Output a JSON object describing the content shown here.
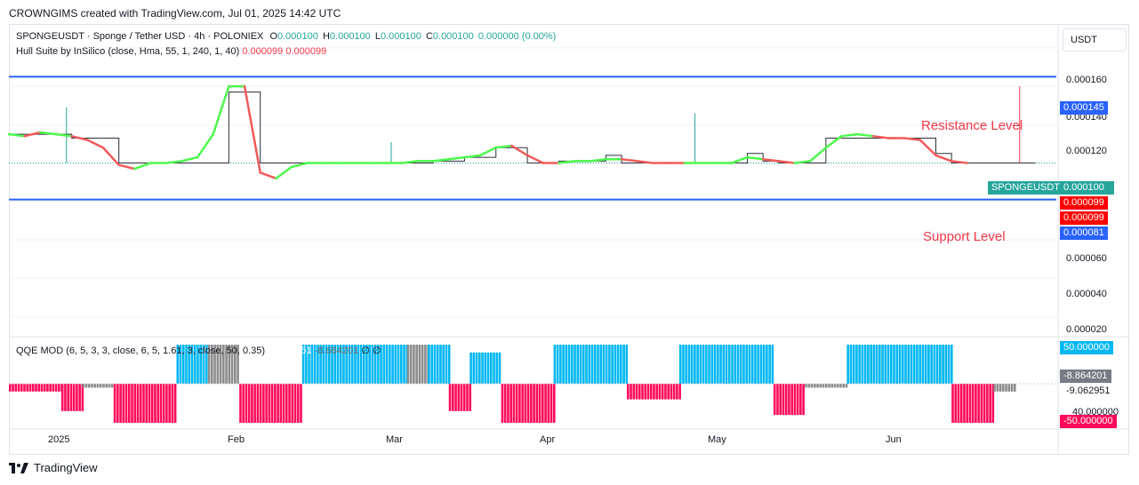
{
  "header": {
    "created_by": "CROWNGIMS created with TradingView.com, Jul 01, 2025 14:42 UTC"
  },
  "price_pane": {
    "symbol_line": {
      "name": "SPONGEUSDT · Sponge / Tether USD · 4h · POLONIEX",
      "o_label": "O",
      "o_value": "0.000100",
      "h_label": "H",
      "h_value": "0.000100",
      "l_label": "L",
      "l_value": "0.000100",
      "c_label": "C",
      "c_value": "0.000100",
      "change": "0.000000 (0.00%)"
    },
    "indicator_line": {
      "name": "Hull Suite by InSilico (close, Hma, 55, 1, 240, 1, 40)",
      "value1": "0.000099",
      "value2": "0.000099"
    },
    "annotations": {
      "resistance": "Resistance Level",
      "support": "Support Level"
    }
  },
  "price_axis": {
    "currency": "USDT",
    "ticks": [
      "0.000160",
      "0.000140",
      "0.000120",
      "0.000060",
      "0.000040",
      "0.000020"
    ],
    "tags": {
      "resistance": "0.000145",
      "symbol": "SPONGEUSDT",
      "last": "0.000100",
      "hull1": "0.000099",
      "hull2": "0.000099",
      "support": "0.000081"
    }
  },
  "qqe_pane": {
    "label": "QQE MOD (6, 5, 3, 3, close, 6, 5, 1.61, 3, close, 50, 0.35)",
    "v1": "-9.062951",
    "v2": "-8.864201",
    "v3": "∅",
    "v4": "∅",
    "axis": {
      "top_tag": "50.000000",
      "mid_tag": "-8.864201",
      "mid_text": "-9.062951",
      "partial": "40.000000",
      "bottom_tag": "-50.000000"
    }
  },
  "time_axis": [
    "2025",
    "Feb",
    "Mar",
    "Apr",
    "May",
    "Jun"
  ],
  "footer": {
    "brand": "TradingView"
  },
  "chart_data": {
    "type": "line",
    "ylim": [
      1e-05,
      0.000172
    ],
    "horizontal_levels": [
      {
        "label": "Resistance Level",
        "value": 0.000145
      },
      {
        "label": "Support Level",
        "value": 8.1e-05
      }
    ],
    "price_series": {
      "x": [
        0,
        3,
        6,
        9,
        12,
        15,
        18,
        21,
        24,
        27,
        30,
        33,
        36,
        39,
        42,
        45,
        48,
        51,
        54,
        57,
        60,
        63,
        66,
        69,
        72,
        75,
        78,
        81,
        84,
        87,
        90,
        93,
        96,
        99,
        102,
        105,
        108,
        111,
        114,
        117,
        120,
        123,
        126,
        129,
        132,
        135,
        138,
        141,
        144,
        147,
        150,
        153,
        156,
        159,
        162,
        165,
        168,
        171,
        174,
        177,
        180,
        183
      ],
      "step": [
        0.000115,
        0.000115,
        0.000115,
        0.000115,
        0.000113,
        0.000113,
        0.000113,
        0.0001,
        0.0001,
        0.0001,
        0.0001,
        0.0001,
        0.0001,
        0.0001,
        0.000137,
        0.000137,
        0.0001,
        0.0001,
        0.0001,
        0.0001,
        0.0001,
        0.0001,
        0.0001,
        0.0001,
        0.0001,
        0.0001,
        0.0001,
        0.000101,
        0.000101,
        0.000103,
        0.000103,
        0.000108,
        0.000108,
        0.0001,
        0.0001,
        0.000101,
        0.000101,
        0.000101,
        0.000104,
        0.0001,
        0.0001,
        0.0001,
        0.0001,
        0.0001,
        0.0001,
        0.0001,
        0.0001,
        0.000105,
        0.000101,
        0.0001,
        0.0001,
        0.0001,
        0.000113,
        0.000113,
        0.000113,
        0.000113,
        0.000113,
        0.000113,
        0.000113,
        0.000105,
        0.0001,
        0.0001
      ],
      "hull": [
        0.000115,
        0.000114,
        0.000116,
        0.000115,
        0.000114,
        0.000112,
        0.000108,
        9.9e-05,
        9.7e-05,
        0.0001,
        0.0001,
        0.000101,
        0.000103,
        0.000115,
        0.00014,
        0.00014,
        9.5e-05,
        9.2e-05,
        9.8e-05,
        0.0001,
        0.0001,
        0.0001,
        0.0001,
        0.0001,
        0.0001,
        0.0001,
        0.000101,
        0.000101,
        0.000102,
        0.000103,
        0.000104,
        0.000108,
        0.000109,
        0.000104,
        0.0001,
        0.0001,
        0.000101,
        0.000101,
        0.000102,
        0.000102,
        0.000101,
        0.0001,
        0.0001,
        0.0001,
        0.0001,
        0.0001,
        0.0001,
        0.000103,
        0.000102,
        0.000101,
        0.0001,
        0.000101,
        0.000108,
        0.000114,
        0.000115,
        0.000114,
        0.000113,
        0.000113,
        0.000112,
        0.000104,
        0.000101,
        0.0001
      ],
      "hull_rising": [
        true,
        false,
        true,
        true,
        false,
        false,
        false,
        false,
        true,
        true,
        true,
        true,
        true,
        true,
        true,
        false,
        false,
        true,
        true,
        true,
        true,
        true,
        true,
        true,
        true,
        true,
        true,
        true,
        true,
        true,
        true,
        true,
        false,
        false,
        false,
        true,
        true,
        true,
        true,
        false,
        false,
        false,
        false,
        true,
        true,
        true,
        true,
        true,
        false,
        false,
        true,
        true,
        true,
        true,
        true,
        false,
        false,
        false,
        false,
        false,
        false,
        false
      ]
    },
    "spikes": [
      {
        "x": 11,
        "high": 0.000129
      },
      {
        "x": 73,
        "high": 0.000111
      },
      {
        "x": 131,
        "high": 0.000126
      },
      {
        "x": 193,
        "high": 0.00014
      }
    ],
    "qqe_series": {
      "range": [
        -50,
        50
      ],
      "blocks": [
        {
          "from": 0,
          "to": 10,
          "level": -10,
          "color": "#ff0a5a"
        },
        {
          "from": 10,
          "to": 14,
          "level": -35,
          "color": "#ff0a5a"
        },
        {
          "from": 14,
          "to": 20,
          "level": -5,
          "color": "#8c8c8c"
        },
        {
          "from": 20,
          "to": 32,
          "level": -50,
          "color": "#ff0a5a"
        },
        {
          "from": 32,
          "to": 38,
          "level": 50,
          "color": "#00b7f2"
        },
        {
          "from": 38,
          "to": 44,
          "level": 50,
          "color": "#8c8c8c"
        },
        {
          "from": 44,
          "to": 56,
          "level": -50,
          "color": "#ff0a5a"
        },
        {
          "from": 56,
          "to": 76,
          "level": 50,
          "color": "#00b7f2"
        },
        {
          "from": 76,
          "to": 80,
          "level": 50,
          "color": "#8c8c8c"
        },
        {
          "from": 80,
          "to": 84,
          "level": 50,
          "color": "#00b7f2"
        },
        {
          "from": 84,
          "to": 88,
          "level": -35,
          "color": "#ff0a5a"
        },
        {
          "from": 88,
          "to": 94,
          "level": 40,
          "color": "#00b7f2"
        },
        {
          "from": 94,
          "to": 104,
          "level": -50,
          "color": "#ff0a5a"
        },
        {
          "from": 104,
          "to": 118,
          "level": 50,
          "color": "#00b7f2"
        },
        {
          "from": 118,
          "to": 128,
          "level": -20,
          "color": "#ff0a5a"
        },
        {
          "from": 128,
          "to": 146,
          "level": 50,
          "color": "#00b7f2"
        },
        {
          "from": 146,
          "to": 152,
          "level": -40,
          "color": "#ff0a5a"
        },
        {
          "from": 152,
          "to": 160,
          "level": -5,
          "color": "#8c8c8c"
        },
        {
          "from": 160,
          "to": 180,
          "level": 50,
          "color": "#00b7f2"
        },
        {
          "from": 180,
          "to": 188,
          "level": -50,
          "color": "#ff0a5a"
        },
        {
          "from": 188,
          "to": 192,
          "level": -10,
          "color": "#8c8c8c"
        }
      ]
    }
  }
}
